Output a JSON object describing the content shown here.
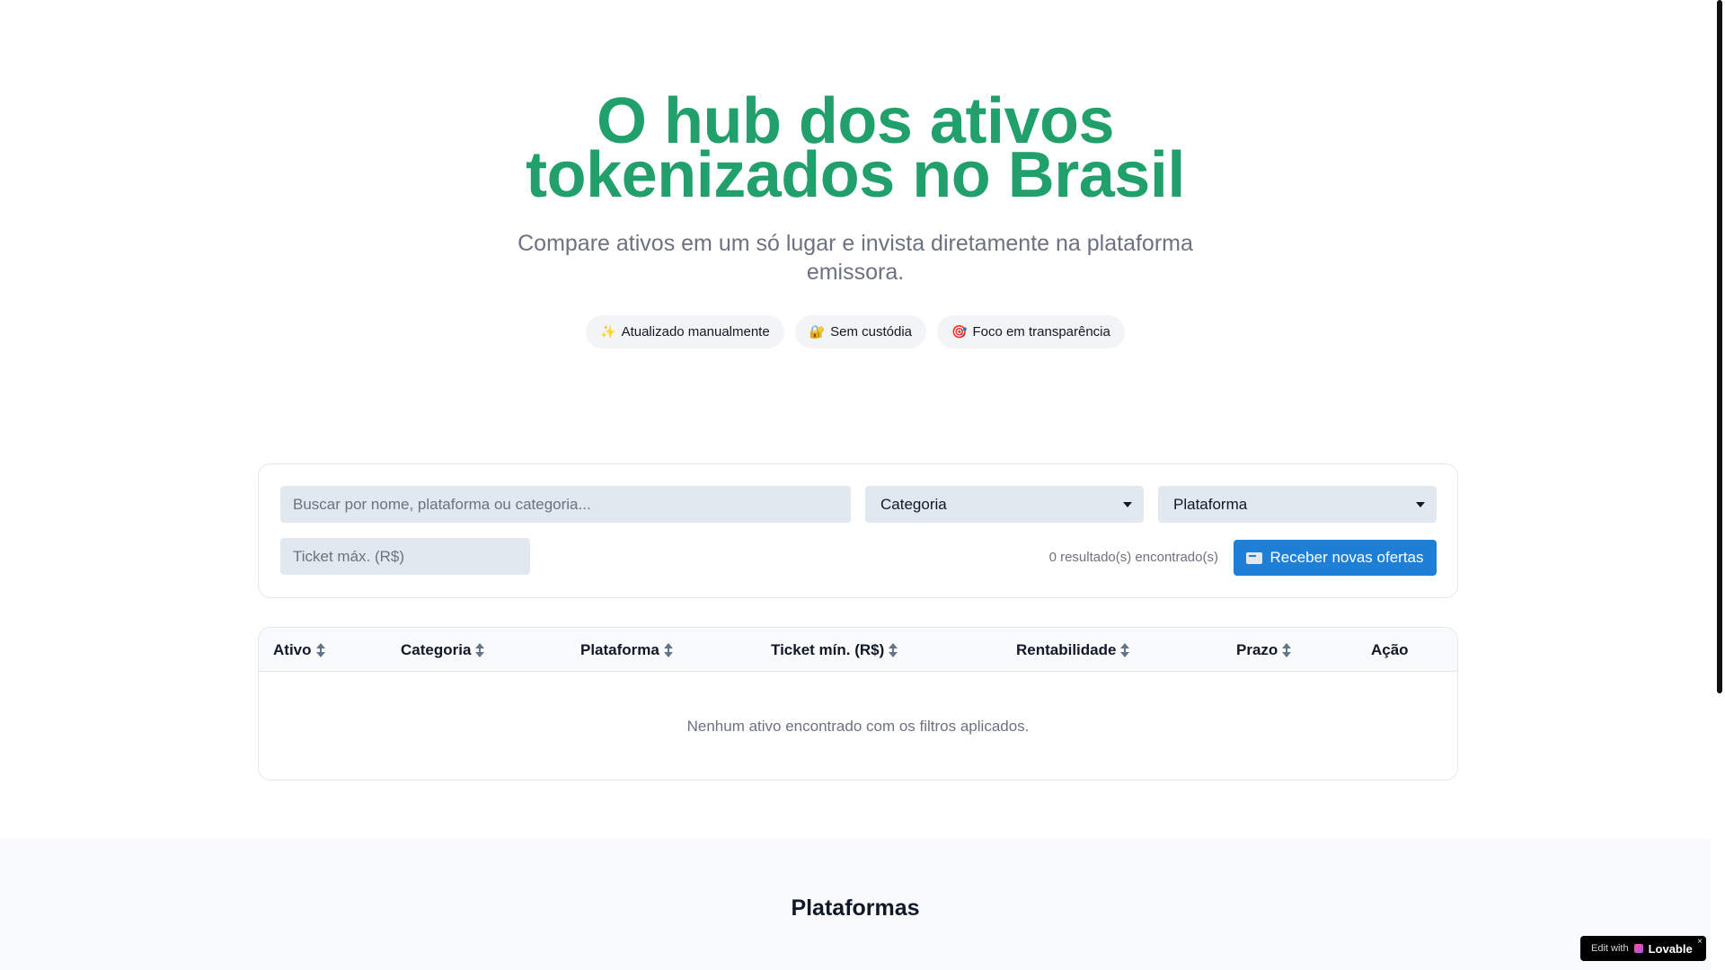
{
  "hero": {
    "title_line1": "O hub dos ativos",
    "title_line2": "tokenizados no Brasil",
    "subtitle": "Compare ativos em um só lugar e invista diretamente na plataforma emissora.",
    "pills": [
      {
        "emoji": "✨",
        "label": "Atualizado manualmente"
      },
      {
        "emoji": "🔐",
        "label": "Sem custódia"
      },
      {
        "emoji": "🎯",
        "label": "Foco em transparência"
      }
    ]
  },
  "filters": {
    "search_placeholder": "Buscar por nome, plataforma ou categoria...",
    "category_select": "Categoria",
    "platform_select": "Plataforma",
    "ticket_placeholder": "Ticket máx. (R$)",
    "results_text": "0 resultado(s) encontrado(s)",
    "offers_button": "Receber novas ofertas"
  },
  "table": {
    "columns": [
      "Ativo",
      "Categoria",
      "Plataforma",
      "Ticket mín. (R$)",
      "Rentabilidade",
      "Prazo",
      "Ação"
    ],
    "empty_message": "Nenhum ativo encontrado com os filtros aplicados."
  },
  "platforms": {
    "title": "Plataformas"
  },
  "badge": {
    "edit_label": "Edit with",
    "brand": "Lovable",
    "close": "×"
  },
  "colors": {
    "accent_green": "#22a06b",
    "button_blue": "#1d7fd6",
    "input_bg": "#e2e8f0"
  }
}
